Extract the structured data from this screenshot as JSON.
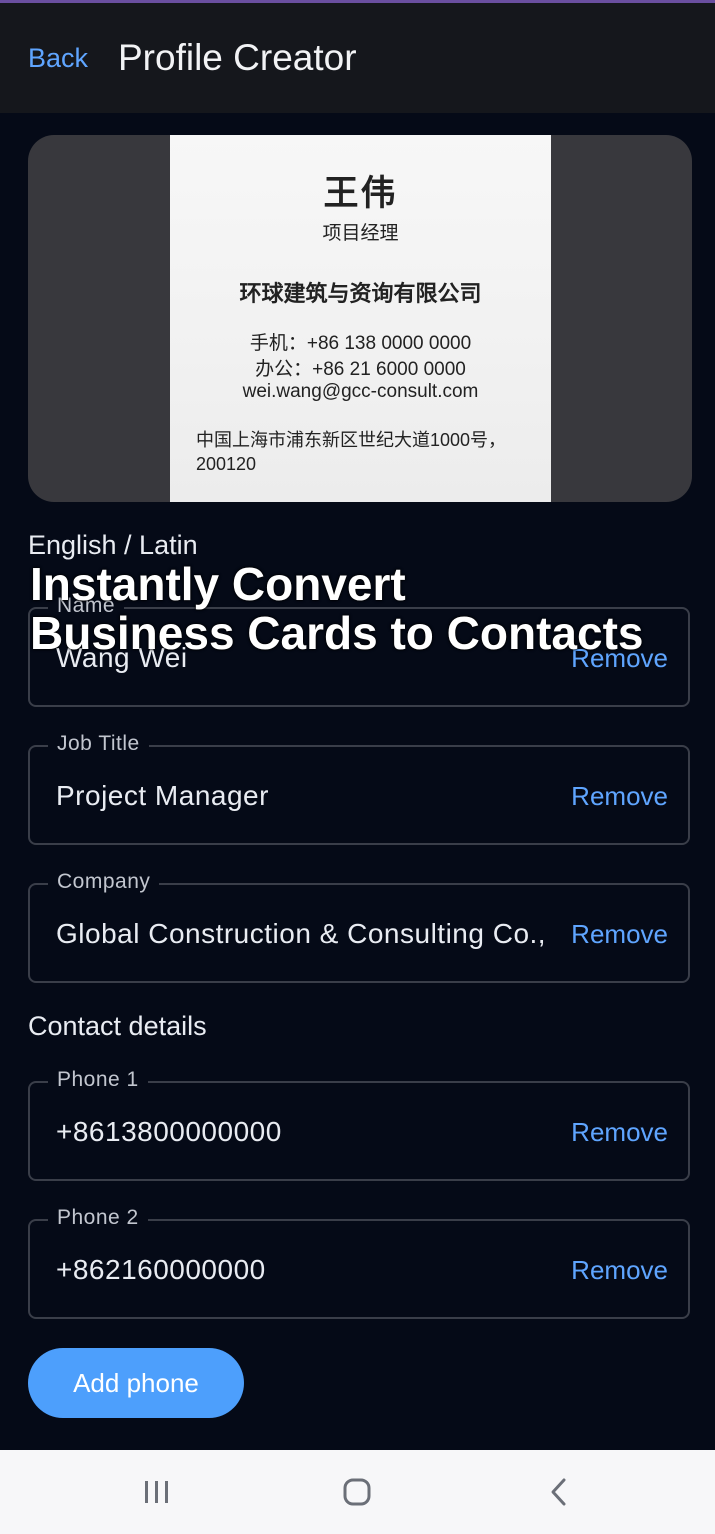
{
  "header": {
    "back_label": "Back",
    "title": "Profile Creator"
  },
  "card_preview": {
    "name": "王伟",
    "title": "项目经理",
    "company": "环球建筑与资询有限公司",
    "mobile": "手机：+86 138 0000 0000",
    "office": "办公：+86 21 6000 0000",
    "email": "wei.wang@gcc-consult.com",
    "address_line1": "中国上海市浦东新区世纪大道1000号，",
    "address_line2": "200120"
  },
  "overlay": {
    "line1": "Instantly Convert",
    "line2": "Business Cards to Contacts"
  },
  "sections": {
    "latin": "English / Latin",
    "contact": "Contact details"
  },
  "fields": {
    "name": {
      "label": "Name",
      "value": "Wang Wei",
      "remove": "Remove"
    },
    "job_title": {
      "label": "Job Title",
      "value": "Project Manager",
      "remove": "Remove"
    },
    "company": {
      "label": "Company",
      "value": "Global Construction & Consulting Co., Ltd.",
      "remove": "Remove"
    },
    "phone1": {
      "label": "Phone 1",
      "value": "+8613800000000",
      "remove": "Remove"
    },
    "phone2": {
      "label": "Phone 2",
      "value": "+862160000000",
      "remove": "Remove"
    }
  },
  "actions": {
    "add_phone": "Add phone"
  },
  "nav": {
    "icons": [
      "recents-icon",
      "home-icon",
      "back-icon"
    ]
  },
  "colors": {
    "background": "#050a17",
    "accent": "#5fa5ff",
    "button": "#4d9ffc",
    "header": "#15171c"
  }
}
